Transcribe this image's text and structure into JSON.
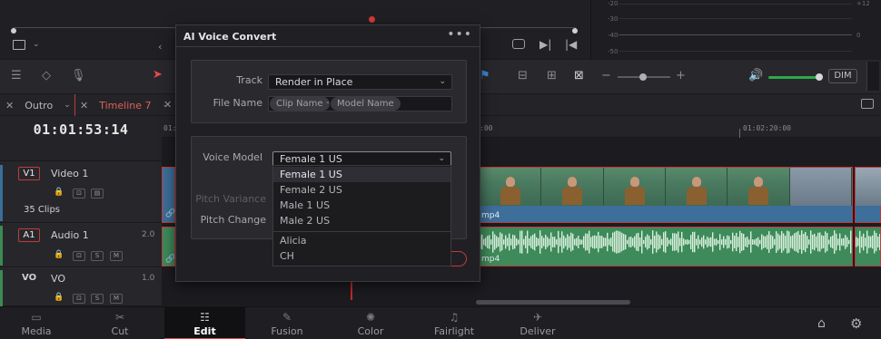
{
  "tabs": [
    {
      "label": "Outro"
    },
    {
      "label": "Timeline 7"
    }
  ],
  "timecode": "01:01:53:14",
  "ruler": {
    "labels": [
      "01:0",
      ":00",
      "01:02:20:00"
    ]
  },
  "scopes": {
    "labels": [
      "-20",
      "-30",
      "-40",
      "-50",
      "+12",
      "0"
    ]
  },
  "toolbar": {
    "dim_label": "DIM"
  },
  "tracks": {
    "v1": {
      "tag": "V1",
      "name": "Video 1",
      "clips_count": "35 Clips"
    },
    "a1": {
      "tag": "A1",
      "name": "Audio 1",
      "level": "2.0",
      "s": "S",
      "m": "M"
    },
    "vo": {
      "tag": "VO",
      "name": "VO",
      "level": "1.0",
      "s": "S",
      "m": "M"
    }
  },
  "clips": {
    "video_suffix": "mp4",
    "audio_suffix": "mp4"
  },
  "dialog": {
    "title": "AI Voice Convert",
    "menu": "•••",
    "track_label": "Track",
    "track_value": "Render in Place",
    "file_name_label": "File Name",
    "file_name_chips": [
      "Clip Name",
      "Model Name"
    ],
    "file_name_sep": "-",
    "voice_model_label": "Voice Model",
    "voice_model_value": "Female 1 US",
    "pitch_variance_label": "Pitch Variance",
    "pitch_change_label": "Pitch Change",
    "options": [
      "Female 1 US",
      "Female 2 US",
      "Male 1 US",
      "Male 2 US",
      "Alicia",
      "CH"
    ]
  },
  "nav": [
    {
      "label": "Media",
      "icon": "media-icon"
    },
    {
      "label": "Cut",
      "icon": "cut-icon"
    },
    {
      "label": "Edit",
      "icon": "edit-icon"
    },
    {
      "label": "Fusion",
      "icon": "fusion-icon"
    },
    {
      "label": "Color",
      "icon": "color-icon"
    },
    {
      "label": "Fairlight",
      "icon": "fairlight-icon"
    },
    {
      "label": "Deliver",
      "icon": "deliver-icon"
    }
  ],
  "colors": {
    "accent": "#e84a4a",
    "active_tab": "#e0605a",
    "audio_clip": "#3e8a5a",
    "video_clip": "#3e6e9a",
    "playhead": "#c42a2a"
  }
}
